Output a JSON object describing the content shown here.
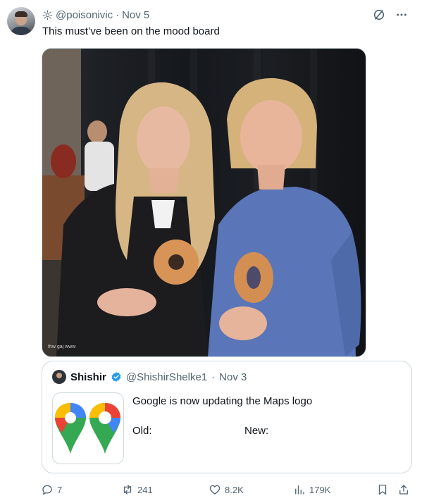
{
  "tweet": {
    "handle": "@poisonivic",
    "separator": "·",
    "date": "Nov 5",
    "text": "This must’ve been on the mood board",
    "more_icon": "more-dots-icon",
    "grok_icon": "slash-circle-icon"
  },
  "photo": {
    "watermark": "thw gaj www"
  },
  "quote": {
    "name": "Shishir",
    "handle": "@ShishirShelke1",
    "separator": "·",
    "date": "Nov 3",
    "text": "Google is now updating the Maps logo",
    "old_label": "Old:",
    "new_label": "New:"
  },
  "actions": {
    "replies": "7",
    "reposts": "241",
    "likes": "8.2K",
    "views": "179K"
  },
  "colors": {
    "verified": "#1d9bf0",
    "text_secondary": "#536471"
  }
}
